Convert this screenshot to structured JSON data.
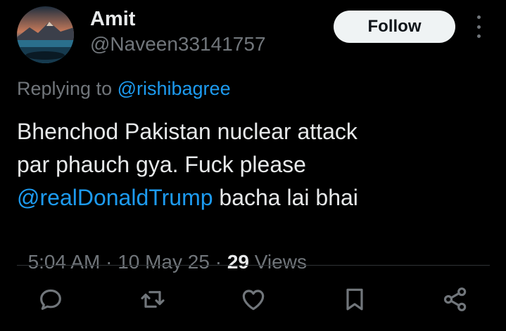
{
  "user": {
    "display_name": "Amit",
    "handle": "@Naveen33141757",
    "follow_label": "Follow",
    "more_icon": "more-vertical-icon"
  },
  "reply_context": {
    "prefix": "Replying to ",
    "mention": "@rishibagree"
  },
  "tweet": {
    "line1": "Bhenchod Pakistan nuclear attack",
    "line2": "par phauch gya. Fuck please",
    "mention": "@realDonaldTrump",
    "line3_rest": " bacha lai bhai"
  },
  "meta": {
    "time": "5:04 AM",
    "sep1": " · ",
    "date": "10 May 25",
    "sep2": " · ",
    "views_count": "29",
    "views_label": " Views"
  },
  "actions": [
    {
      "name": "reply-icon"
    },
    {
      "name": "retweet-icon"
    },
    {
      "name": "like-icon"
    },
    {
      "name": "bookmark-icon"
    },
    {
      "name": "share-icon"
    }
  ],
  "colors": {
    "background": "#000000",
    "text": "#e7e9ea",
    "secondary": "#71767b",
    "link": "#1d9bf0",
    "divider": "#2f3336"
  }
}
